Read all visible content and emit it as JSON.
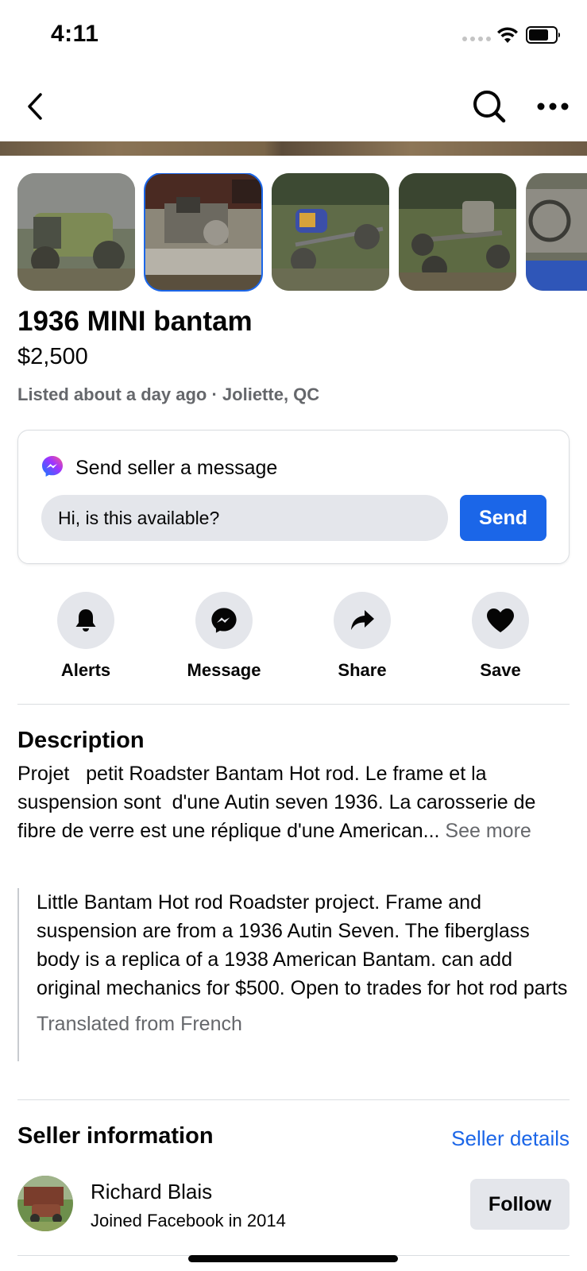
{
  "status_bar": {
    "time": "4:11"
  },
  "nav": {
    "back_icon": "chevron-left-icon",
    "search_icon": "search-icon",
    "more_icon": "more-horizontal-icon"
  },
  "gallery": {
    "thumbnails": [
      {
        "name": "photo-1",
        "selected": false
      },
      {
        "name": "photo-2",
        "selected": true
      },
      {
        "name": "photo-3",
        "selected": false
      },
      {
        "name": "photo-4",
        "selected": false
      },
      {
        "name": "photo-5",
        "selected": false
      }
    ]
  },
  "listing": {
    "title": "1936 MINI bantam",
    "price": "$2,500",
    "listed": "Listed about a day ago · Joliette, QC"
  },
  "message_card": {
    "title": "Send seller a message",
    "input_value": "Hi, is this available?",
    "send_label": "Send"
  },
  "actions": [
    {
      "label": "Alerts",
      "icon": "bell-icon"
    },
    {
      "label": "Message",
      "icon": "messenger-icon"
    },
    {
      "label": "Share",
      "icon": "share-arrow-icon"
    },
    {
      "label": "Save",
      "icon": "heart-icon"
    }
  ],
  "description": {
    "heading": "Description",
    "body": "Projet   petit Roadster Bantam Hot rod. Le frame et la suspension sont  d'une Autin seven 1936. La carosserie de fibre de verre est une réplique d'une American... ",
    "see_more": "See more",
    "translation": "Little Bantam Hot rod Roadster project. Frame and suspension are from a 1936 Autin Seven. The fiberglass body is a replica of a 1938 American Bantam. can add original mechanics for $500. Open to trades for hot rod parts",
    "translated_from": "Translated from French"
  },
  "seller": {
    "heading": "Seller information",
    "details_link": "Seller details",
    "name": "Richard Blais",
    "joined": "Joined Facebook in 2014",
    "follow_label": "Follow"
  },
  "colors": {
    "accent": "#1b66e8",
    "secondary_text": "#65676b",
    "button_bg": "#e4e6eb"
  }
}
